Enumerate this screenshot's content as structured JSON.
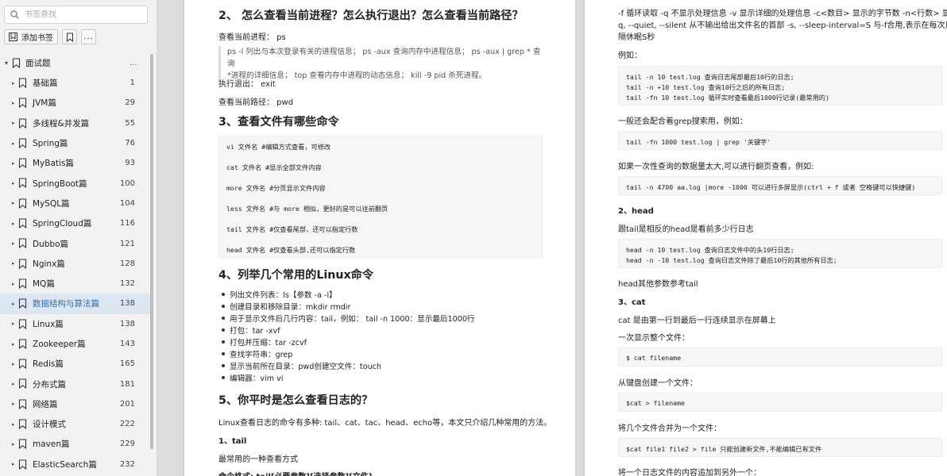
{
  "sidebar": {
    "search_placeholder": "书签查找",
    "add_bookmark_label": "添加书签",
    "more_label": "...",
    "root": {
      "label": "面试题",
      "dots": "..."
    },
    "items": [
      {
        "label": "基础篇",
        "count": "1"
      },
      {
        "label": "JVM篇",
        "count": "29"
      },
      {
        "label": "多线程&并发篇",
        "count": "55"
      },
      {
        "label": "Spring篇",
        "count": "76"
      },
      {
        "label": "MyBatis篇",
        "count": "93"
      },
      {
        "label": "SpringBoot篇",
        "count": "100"
      },
      {
        "label": "MySQL篇",
        "count": "104"
      },
      {
        "label": "SpringCloud篇",
        "count": "116"
      },
      {
        "label": "Dubbo篇",
        "count": "121"
      },
      {
        "label": "Nginx篇",
        "count": "128"
      },
      {
        "label": "MQ篇",
        "count": "132"
      },
      {
        "label": "数据结构与算法篇",
        "count": "138"
      },
      {
        "label": "Linux篇",
        "count": "138"
      },
      {
        "label": "Zookeeper篇",
        "count": "143"
      },
      {
        "label": "Redis篇",
        "count": "165"
      },
      {
        "label": "分布式篇",
        "count": "181"
      },
      {
        "label": "网络篇",
        "count": "201"
      },
      {
        "label": "设计模式",
        "count": "222"
      },
      {
        "label": "maven篇",
        "count": "229"
      },
      {
        "label": "ElasticSearch篇",
        "count": "232"
      }
    ]
  },
  "left": {
    "h2": "2、 怎么查看当前进程？怎么执行退出？怎么查看当前路径？",
    "p_process": "查看当前进程： ps",
    "quote_line1": "ps -l 列出与本次登录有关的进程信息； ps -aux 查询内存中进程信息； ps -aux | grep * 查询",
    "quote_line2": "*进程的详细信息； top 查看内存中进程的动态信息； kill -9 pid 杀死进程。",
    "p_exit": "执行退出： exit",
    "p_path": "查看当前路径： pwd",
    "h3": "3、查看文件有哪些命令",
    "code3": [
      "vi 文件名 #编辑方式查看，可修改",
      "cat 文件名 #显示全部文件内容",
      "more 文件名 #分页显示文件内容",
      "less 文件名 #与 more 相似，更好的是可以往前翻页",
      "tail 文件名 #仅查看尾部，还可以指定行数",
      "head 文件名 #仅查看头部,还可以指定行数"
    ],
    "h4": "4、列举几个常用的Linux命令",
    "bullets": [
      "列出文件列表：ls【参数 -a -l】",
      "创建目录和移除目录：mkdir rmdir",
      "用于显示文件后几行内容：tail，例如： tail -n 1000：显示最后1000行",
      "打包：tar -xvf",
      "打包并压缩：tar -zcvf",
      "查找字符串：grep",
      "显示当前所在目录：pwd创建空文件：touch",
      "编辑器：vim vi"
    ],
    "h5": "5、你平时是怎么查看日志的？",
    "p_log": "Linux查看日志的命令有多种: tail、cat、tac、head、echo等，本文只介绍几种常用的方法。",
    "h_tail": "1、tail",
    "p_tail": "最常用的一种查看方式",
    "p_format": "命令格式: tail[必要参数][选择参数][文件]"
  },
  "right": {
    "p1_line1": "-f 循环读取 -q 不显示处理信息 -v 显示详细的处理信息 -c<数目> 显示的字节数 -n<行数> 显示行数 -",
    "p1_line2": "q, --quiet, --silent 从不输出给出文件名的首部 -s, --sleep-interval=S 与-f合用,表示在每次反复的间",
    "p1_line3": "隔休眠S秒",
    "p_example": "例如：",
    "code1": [
      "tail -n 10 test.log 查询日志尾部最后10行的日志;",
      "tail -n +10 test.log 查询10行之后的所有日志;",
      "tail -fn 10 test.log 循环实时查看最后1000行记录(最常用的)"
    ],
    "p_grep": "一般还会配合着grep搜索用，例如：",
    "code2": [
      "tail -fn 1000 test.log | grep '关键字'"
    ],
    "p_big": "如果一次性查询的数据量太大,可以进行翻页查看，例如:",
    "code3": [
      "tail -n 4700 aa.log |more -1000 可以进行多屏显示(ctrl + f 或者 空格键可以快捷键)"
    ],
    "h_head": "2、head",
    "p_head": "跟tail是相反的head是看前多少行日志",
    "code4": [
      "head -n 10 test.log 查询日志文件中的头10行日志;",
      "head -n -10 test.log 查询日志文件除了最后10行的其他所有日志;"
    ],
    "p_headmore": "head其他参数参考tail",
    "h_cat": "3、cat",
    "p_cat": "cat 是由第一行到最后一行连续显示在屏幕上",
    "p_once": "一次显示整个文件：",
    "code5": [
      "$ cat filename"
    ],
    "p_create": "从键盘创建一个文件：",
    "code6": [
      "$cat > filename"
    ],
    "p_merge": "将几个文件合并为一个文件：",
    "code7": [
      "$cat file1 file2 > file 只能创建新文件,不能编辑已有文件"
    ],
    "p_append": "将一个日志文件的内容追加到另外一个："
  },
  "colors": {
    "accent": "#2f6fb8",
    "selected_bg": "#dde7f3"
  }
}
